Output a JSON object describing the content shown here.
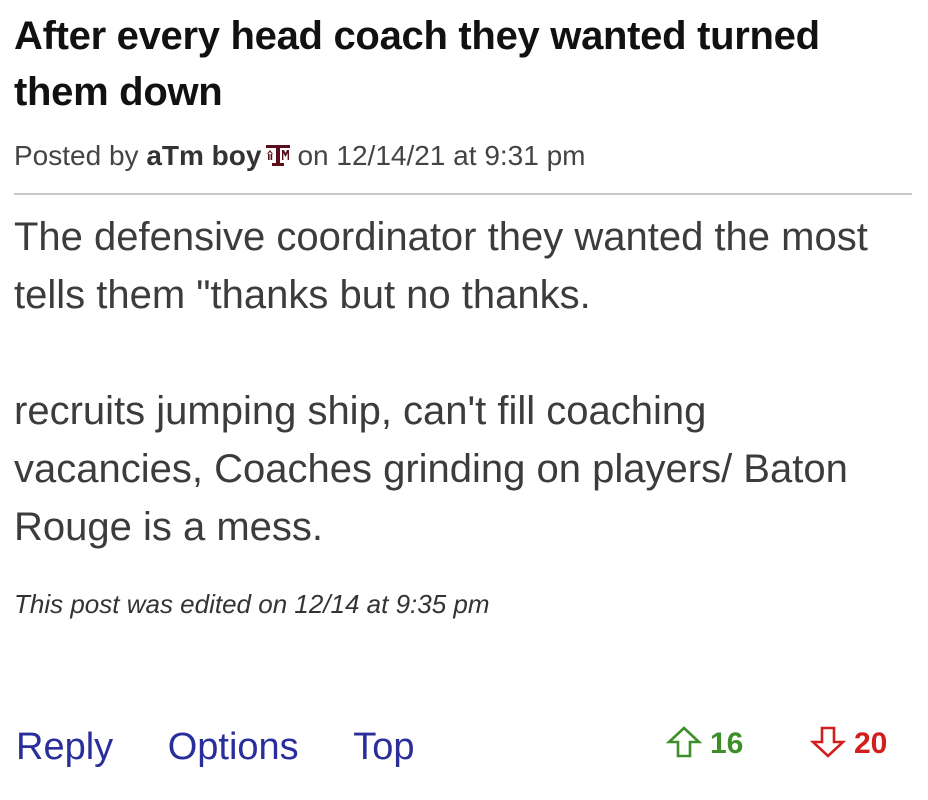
{
  "post": {
    "title": "After every head coach they wanted turned them down",
    "byline": {
      "prefix": "Posted by",
      "author": "aTm boy",
      "team_icon": "texas-am-logo-icon",
      "on_label": "on",
      "date": "12/14/21",
      "at_label": "at",
      "time": "9:31 pm"
    },
    "body": {
      "paragraph_1": "The defensive coordinator they wanted the most tells them \"thanks but no thanks.",
      "paragraph_2": "recruits jumping ship, can't fill coaching vacancies, Coaches grinding on players/ Baton Rouge is a mess."
    },
    "edited_note": "This post was edited on 12/14 at 9:35 pm"
  },
  "actions": {
    "reply_label": "Reply",
    "options_label": "Options",
    "top_label": "Top"
  },
  "votes": {
    "up_icon": "arrow-up-icon",
    "up_count": "16",
    "up_color": "#3e8f28",
    "down_icon": "arrow-down-icon",
    "down_count": "20",
    "down_color": "#d31e1e"
  },
  "colors": {
    "link": "#2a2e9a",
    "title": "#111111",
    "text": "#3c3c3c",
    "logo": "#5a0f1a"
  }
}
